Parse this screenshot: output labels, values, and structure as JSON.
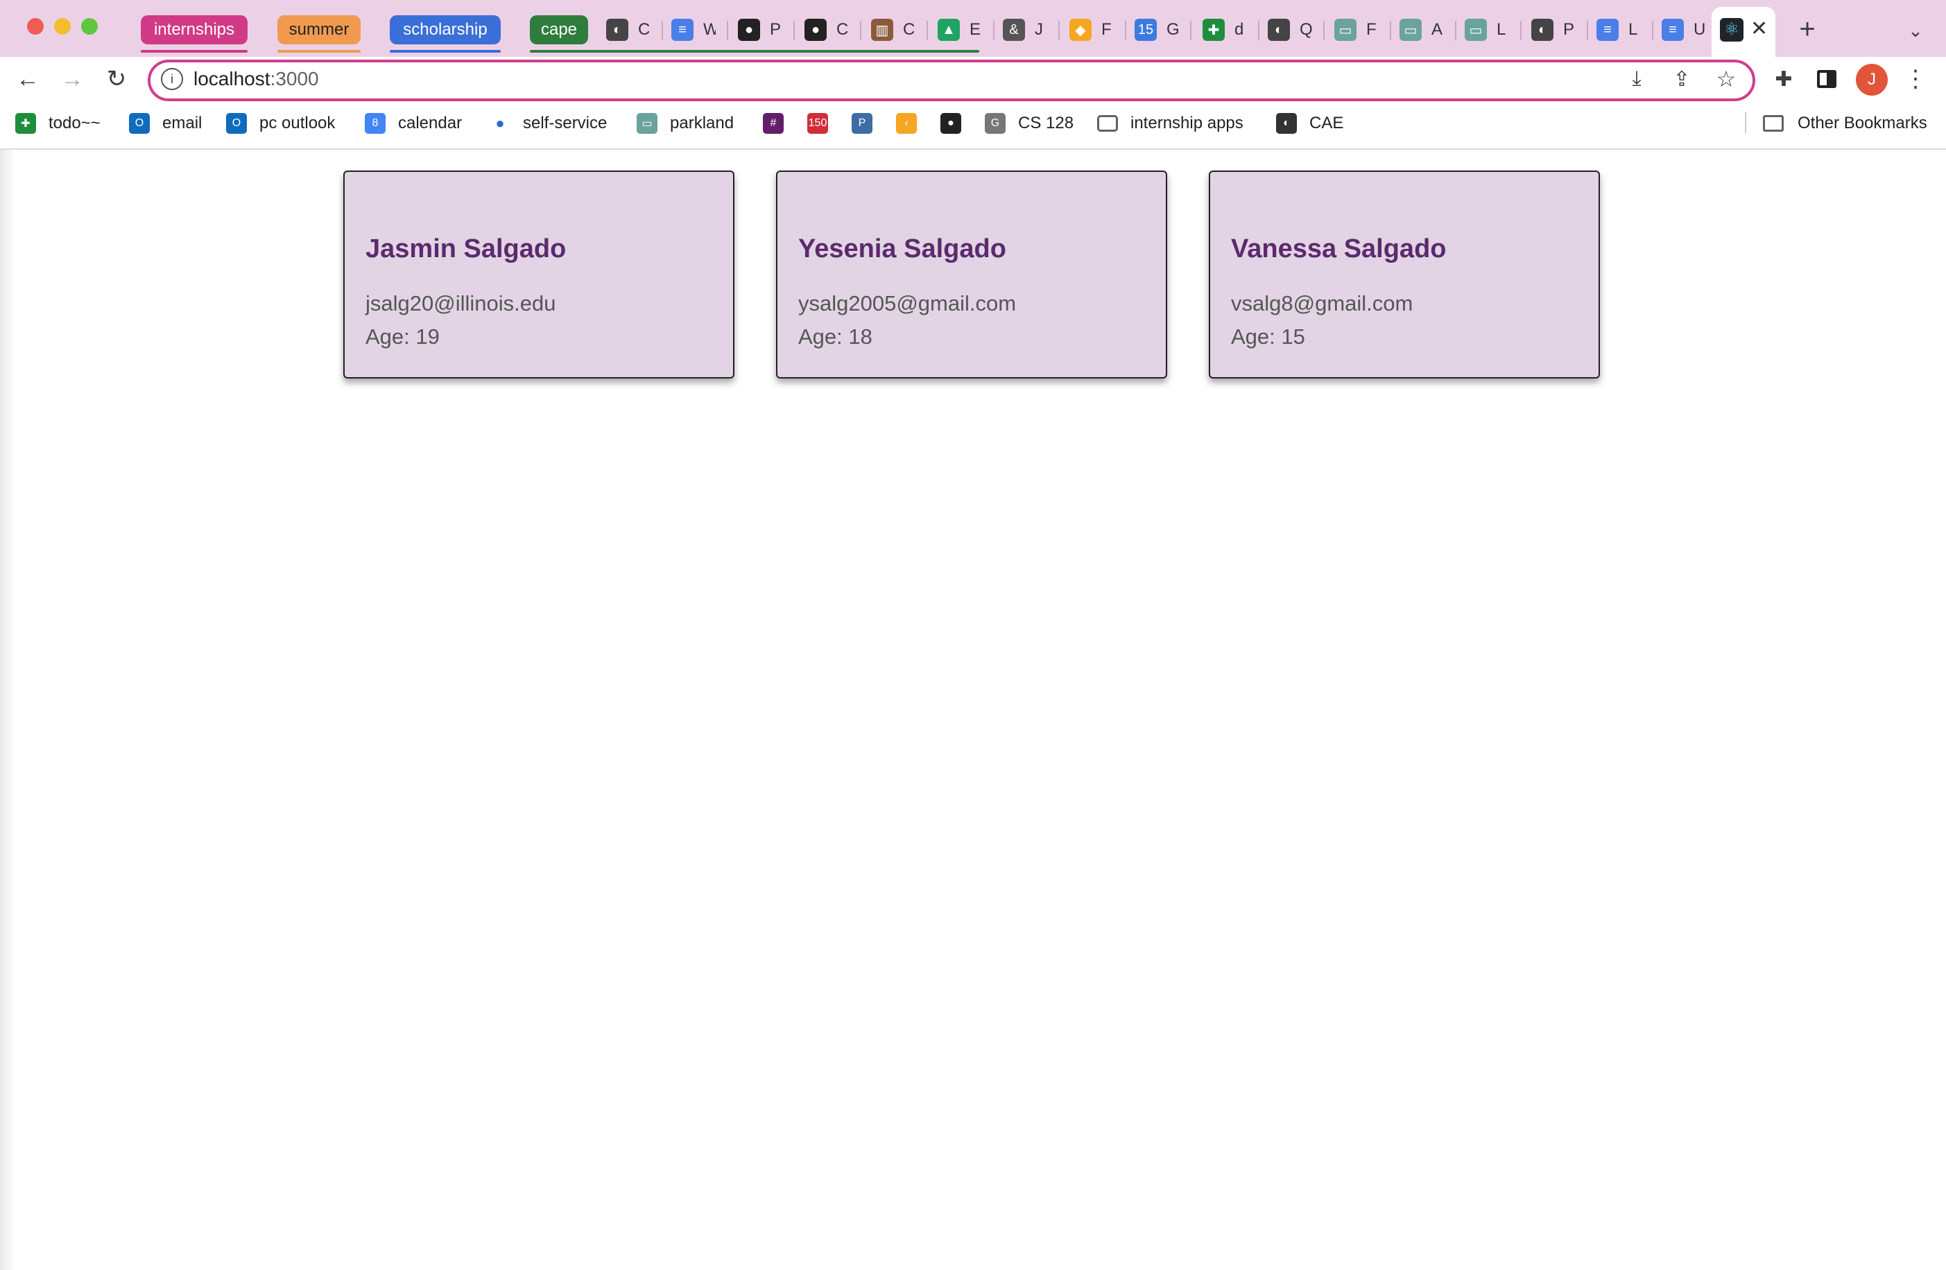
{
  "window": {
    "tab_groups": [
      {
        "label": "internships",
        "color": "#d13a86"
      },
      {
        "label": "summer",
        "color": "#f09a50"
      },
      {
        "label": "scholarship",
        "color": "#3a6fd8"
      },
      {
        "label": "cape",
        "color": "#2f7d3c"
      }
    ],
    "tabs": [
      {
        "label": "C",
        "icon": "globe-icon"
      },
      {
        "label": "W",
        "icon": "google-docs-icon"
      },
      {
        "label": "P",
        "icon": "github-icon"
      },
      {
        "label": "C",
        "icon": "github-icon"
      },
      {
        "label": "C",
        "icon": "books-icon"
      },
      {
        "label": "E",
        "icon": "google-drive-icon"
      },
      {
        "label": "J",
        "icon": "ampersand-icon"
      },
      {
        "label": "F",
        "icon": "airtable-icon"
      },
      {
        "label": "G",
        "icon": "calendar-icon"
      },
      {
        "label": "d",
        "icon": "google-sheets-icon"
      },
      {
        "label": "Q",
        "icon": "globe-icon"
      },
      {
        "label": "F",
        "icon": "reader-icon"
      },
      {
        "label": "A",
        "icon": "reader-icon"
      },
      {
        "label": "L",
        "icon": "reader-icon"
      },
      {
        "label": "P",
        "icon": "globe-icon"
      },
      {
        "label": "L",
        "icon": "google-docs-icon"
      },
      {
        "label": "U",
        "icon": "google-docs-icon"
      }
    ],
    "active_tab_icon": "react-icon",
    "new_tab_label": "+",
    "profile_initial": "J"
  },
  "address_bar": {
    "host": "localhost",
    "port": ":3000"
  },
  "bookmarks": [
    {
      "label": "todo~~",
      "icon": "google-sheets-icon"
    },
    {
      "label": "email",
      "icon": "outlook-icon"
    },
    {
      "label": "pc outlook",
      "icon": "outlook-icon"
    },
    {
      "label": "calendar",
      "icon": "google-calendar-icon"
    },
    {
      "label": "self-service",
      "icon": "blue-dot-icon"
    },
    {
      "label": "parkland",
      "icon": "reader-icon"
    },
    {
      "label": "",
      "icon": "slack-icon"
    },
    {
      "label": "",
      "icon": "badge-150-icon"
    },
    {
      "label": "",
      "icon": "p-icon"
    },
    {
      "label": "",
      "icon": "leetcode-icon"
    },
    {
      "label": "",
      "icon": "github-icon"
    },
    {
      "label": "CS 128",
      "icon": "g-icon"
    },
    {
      "label": "internship apps",
      "icon": "folder-icon"
    },
    {
      "label": "CAE",
      "icon": "globe-icon"
    }
  ],
  "other_bookmarks": "Other Bookmarks",
  "cards": [
    {
      "name": "Jasmin Salgado",
      "email": "jsalg20@illinois.edu",
      "age": "Age: 19"
    },
    {
      "name": "Yesenia Salgado",
      "email": "ysalg2005@gmail.com",
      "age": "Age: 18"
    },
    {
      "name": "Vanessa Salgado",
      "email": "vsalg8@gmail.com",
      "age": "Age: 15"
    }
  ]
}
